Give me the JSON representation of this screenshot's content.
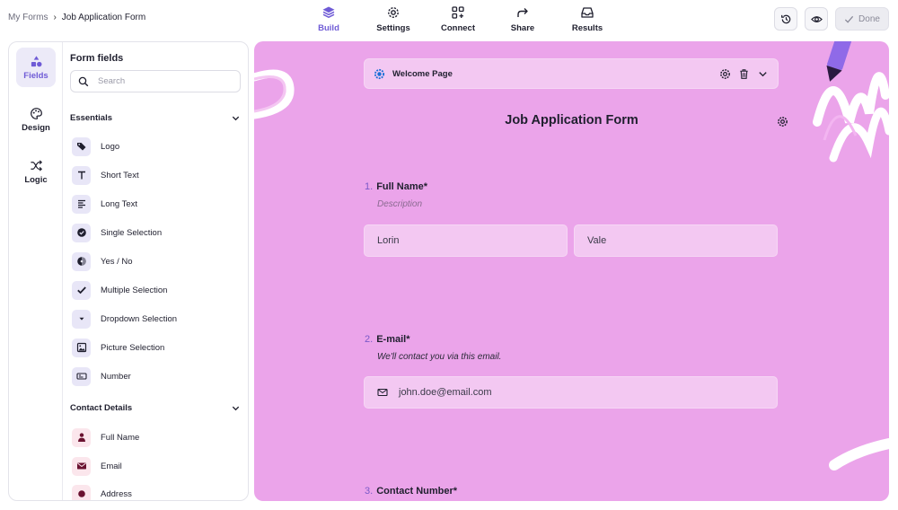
{
  "breadcrumb": {
    "home": "My Forms",
    "separator": "›",
    "current": "Job Application Form"
  },
  "nav": {
    "tabs": [
      {
        "label": "Build",
        "icon": "layers-icon",
        "active": true
      },
      {
        "label": "Settings",
        "icon": "gear-icon",
        "active": false
      },
      {
        "label": "Connect",
        "icon": "grid-plus-icon",
        "active": false
      },
      {
        "label": "Share",
        "icon": "share-arrow-icon",
        "active": false
      },
      {
        "label": "Results",
        "icon": "inbox-icon",
        "active": false
      }
    ]
  },
  "toolbar": {
    "history_icon": "history-icon",
    "preview_icon": "eye-icon",
    "done_label": "Done"
  },
  "rail": {
    "items": [
      {
        "label": "Fields",
        "icon": "shapes-icon",
        "active": true
      },
      {
        "label": "Design",
        "icon": "palette-icon",
        "active": false
      },
      {
        "label": "Logic",
        "icon": "shuffle-icon",
        "active": false
      }
    ]
  },
  "fields_panel": {
    "title": "Form fields",
    "search_placeholder": "Search",
    "sections": [
      {
        "title": "Essentials",
        "items": [
          {
            "label": "Logo",
            "icon": "tags-icon"
          },
          {
            "label": "Short Text",
            "icon": "text-t-icon"
          },
          {
            "label": "Long Text",
            "icon": "align-left-icon"
          },
          {
            "label": "Single Selection",
            "icon": "check-circle-icon"
          },
          {
            "label": "Yes / No",
            "icon": "yes-no-icon"
          },
          {
            "label": "Multiple Selection",
            "icon": "checkmark-icon"
          },
          {
            "label": "Dropdown Selection",
            "icon": "dropdown-icon"
          },
          {
            "label": "Picture Selection",
            "icon": "image-icon"
          },
          {
            "label": "Number",
            "icon": "number-icon"
          }
        ]
      },
      {
        "title": "Contact Details",
        "items": [
          {
            "label": "Full Name",
            "icon": "user-icon"
          },
          {
            "label": "Email",
            "icon": "envelope-icon"
          },
          {
            "label": "Address",
            "icon": "location-icon"
          }
        ]
      }
    ]
  },
  "canvas": {
    "background": "#eba4ea",
    "welcome": {
      "label": "Welcome Page"
    },
    "form_title": "Job Application Form",
    "questions": [
      {
        "number": "1.",
        "title": "Full Name*",
        "description": "Description",
        "inputs": [
          "Lorin",
          "Vale"
        ]
      },
      {
        "number": "2.",
        "title": "E-mail*",
        "description": "We'll contact you via this email.",
        "inputs": [
          "john.doe@email.com"
        ]
      },
      {
        "number": "3.",
        "title": "Contact Number*"
      }
    ]
  },
  "colors": {
    "accent": "#6f5bd6",
    "canvas_field": "#f3c8f2"
  }
}
